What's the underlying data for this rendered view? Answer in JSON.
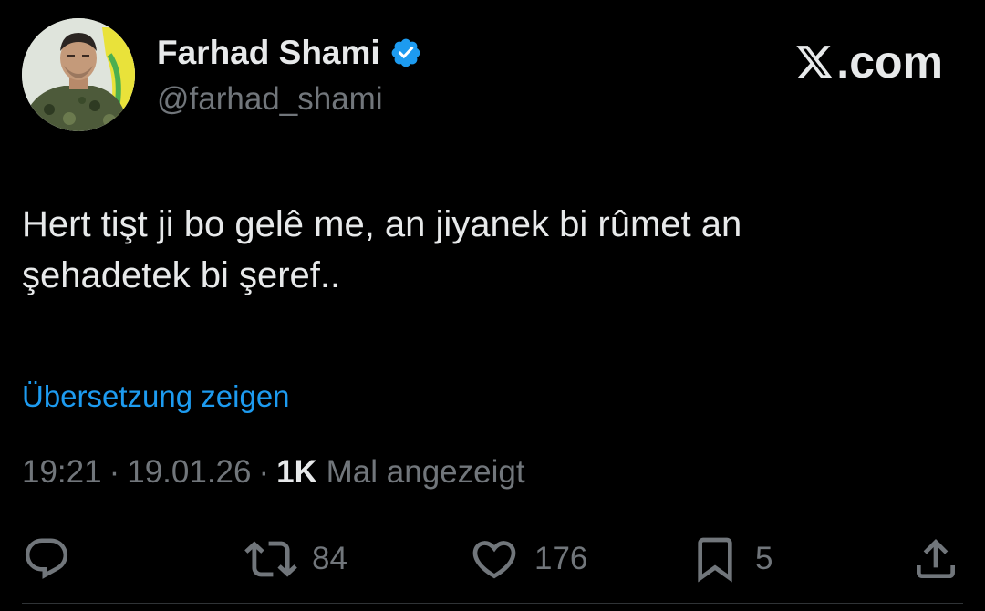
{
  "author": {
    "display_name": "Farhad Shami",
    "handle": "@farhad_shami",
    "verified": true
  },
  "brand": {
    "label": ".com"
  },
  "tweet": {
    "text_line1": "Hert tişt ji bo gelê me, an jiyanek bi rûmet an",
    "text_line2": "şehadetek bi şeref..",
    "translate_label": "Übersetzung zeigen"
  },
  "meta": {
    "time": "19:21",
    "separator": "·",
    "date": "19.01.26",
    "views_count": "1K",
    "views_label": "Mal angezeigt"
  },
  "actions": {
    "reply": {
      "icon": "reply-icon"
    },
    "retweet": {
      "icon": "retweet-icon",
      "count": "84"
    },
    "like": {
      "icon": "heart-icon",
      "count": "176"
    },
    "bookmark": {
      "icon": "bookmark-icon",
      "count": "5"
    },
    "share": {
      "icon": "share-icon"
    }
  },
  "colors": {
    "background": "#000000",
    "text_primary": "#e7e9ea",
    "text_secondary": "#71767b",
    "accent": "#1d9bf0"
  }
}
